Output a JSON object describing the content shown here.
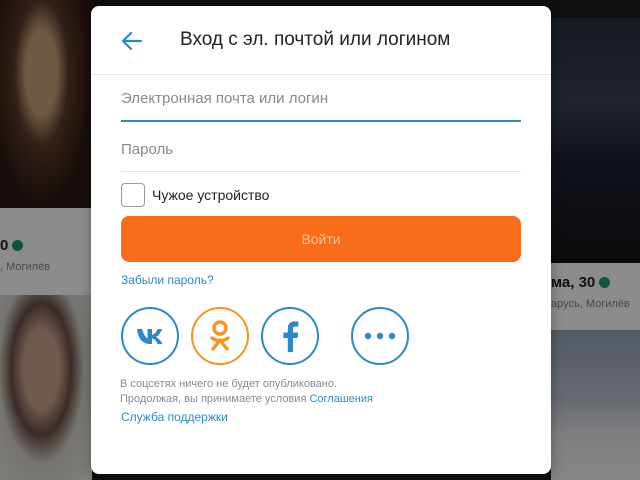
{
  "background": {
    "card_left_name": "0",
    "card_left_location": ", Могилёв",
    "card_right_name": "ма, 30",
    "card_right_location": "арусь, Могилёв"
  },
  "dialog": {
    "title": "Вход с эл. почтой или логином",
    "email_placeholder": "Электронная почта или логин",
    "password_placeholder": "Пароль",
    "device_checkbox_label": "Чужое устройство",
    "login_button": "Войти",
    "forgot_password": "Забыли пароль?",
    "social_icons": [
      "vk-icon",
      "odnoklassniki-icon",
      "facebook-icon",
      "more-icon"
    ],
    "note_line1": "В соцсетях ничего не будет опубликовано.",
    "note_line2": "Продолжая, вы принимаете условия",
    "agreement_link": "Соглашения",
    "support_link": "Служба поддержки"
  },
  "colors": {
    "accent": "#2c88c8",
    "button": "#f86c1a",
    "ok_brand": "#f7931e",
    "online": "#1a9b6b"
  }
}
